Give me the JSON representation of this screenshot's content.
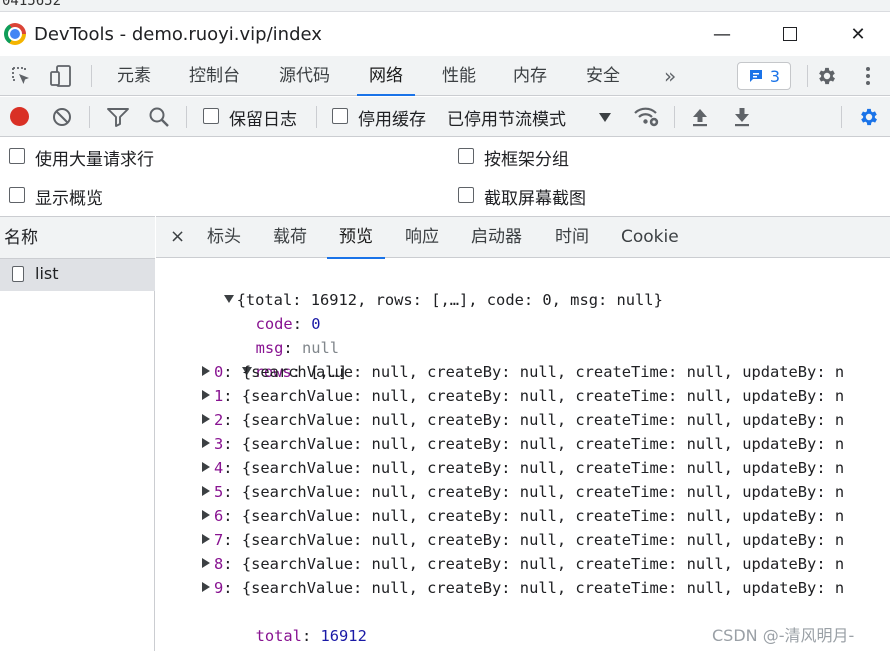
{
  "top_strip": {
    "fragment": "0415652"
  },
  "window": {
    "title": "DevTools - demo.ruoyi.vip/index",
    "min_glyph": "—",
    "close_glyph": "✕"
  },
  "main_tabs": [
    {
      "label": "元素"
    },
    {
      "label": "控制台"
    },
    {
      "label": "源代码"
    },
    {
      "label": "网络"
    },
    {
      "label": "性能"
    },
    {
      "label": "内存"
    },
    {
      "label": "安全"
    }
  ],
  "more_tabs_glyph": "»",
  "issues_count": "3",
  "toolbar": {
    "preserve_log": "保留日志",
    "disable_cache": "停用缓存",
    "throttling": "已停用节流模式"
  },
  "options": {
    "large_rows": "使用大量请求行",
    "group_by_frame": "按框架分组",
    "show_overview": "显示概览",
    "capture_screenshots": "截取屏幕截图"
  },
  "requests": {
    "column_header": "名称",
    "rows": [
      {
        "name": "list"
      }
    ]
  },
  "detail_tabs": {
    "close_glyph": "×",
    "items": [
      {
        "label": "标头"
      },
      {
        "label": "载荷"
      },
      {
        "label": "预览"
      },
      {
        "label": "响应"
      },
      {
        "label": "启动器"
      },
      {
        "label": "时间"
      },
      {
        "label": "Cookie"
      }
    ]
  },
  "preview": {
    "root_summary": "{total: 16912, rows: [,…], code: 0, msg: null}",
    "code": {
      "key": "code",
      "value": "0"
    },
    "msg": {
      "key": "msg",
      "value": "null"
    },
    "rows": {
      "key": "rows",
      "summary": "[,…]"
    },
    "row_items": [
      {
        "index": "0",
        "summary": "{searchValue: null, createBy: null, createTime: null, updateBy: n"
      },
      {
        "index": "1",
        "summary": "{searchValue: null, createBy: null, createTime: null, updateBy: n"
      },
      {
        "index": "2",
        "summary": "{searchValue: null, createBy: null, createTime: null, updateBy: n"
      },
      {
        "index": "3",
        "summary": "{searchValue: null, createBy: null, createTime: null, updateBy: n"
      },
      {
        "index": "4",
        "summary": "{searchValue: null, createBy: null, createTime: null, updateBy: n"
      },
      {
        "index": "5",
        "summary": "{searchValue: null, createBy: null, createTime: null, updateBy: n"
      },
      {
        "index": "6",
        "summary": "{searchValue: null, createBy: null, createTime: null, updateBy: n"
      },
      {
        "index": "7",
        "summary": "{searchValue: null, createBy: null, createTime: null, updateBy: n"
      },
      {
        "index": "8",
        "summary": "{searchValue: null, createBy: null, createTime: null, updateBy: n"
      },
      {
        "index": "9",
        "summary": "{searchValue: null, createBy: null, createTime: null, updateBy: n"
      }
    ],
    "total": {
      "key": "total",
      "value": "16912"
    }
  },
  "watermark": "CSDN @-清风明月-"
}
